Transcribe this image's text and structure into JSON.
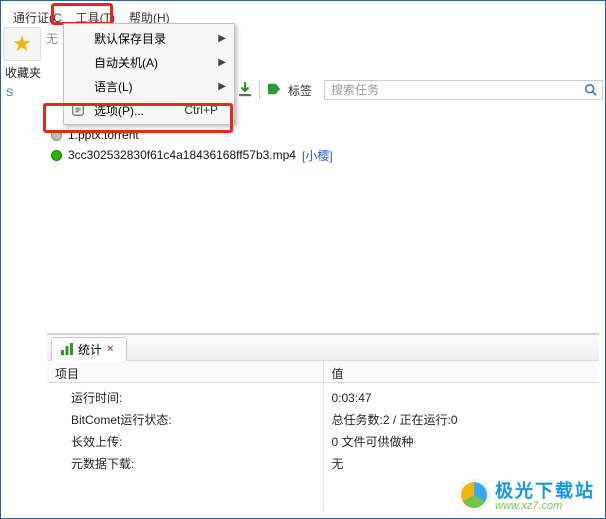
{
  "menubar": {
    "pass": "通行证(C",
    "tools": "工具(T)",
    "help": "帮助(H)"
  },
  "dropdown": {
    "default_dir": "默认保存目录",
    "auto_shutdown": "自动关机(A)",
    "language": "语言(L)",
    "options": "选项(P)...",
    "options_shortcut": "Ctrl+P"
  },
  "sidebar": {
    "star": "★",
    "favorites": "收藏夹",
    "s": "S"
  },
  "small_left_text": "无",
  "toolbar": {
    "tag_label": "标签",
    "search_placeholder": "搜索任务"
  },
  "files": [
    {
      "name": "1.pptx.torrent",
      "status": "pending"
    },
    {
      "name": "3cc302532830f61c4a18436168ff57b3.mp4",
      "status": "active",
      "tag": "[小樱]"
    }
  ],
  "bottom": {
    "tab": "统计",
    "left_header": "项目",
    "right_header": "值",
    "rows": [
      {
        "label": "运行时间:",
        "value": "0:03:47"
      },
      {
        "label": "BitComet运行状态:",
        "value": "总任务数:2 / 正在运行:0"
      },
      {
        "label": "长效上传:",
        "value": "0 文件可供做种"
      },
      {
        "label": "元数据下载:",
        "value": "无"
      }
    ]
  },
  "watermark": {
    "line1": "极光下载站",
    "line2": "www.xz7.com"
  }
}
